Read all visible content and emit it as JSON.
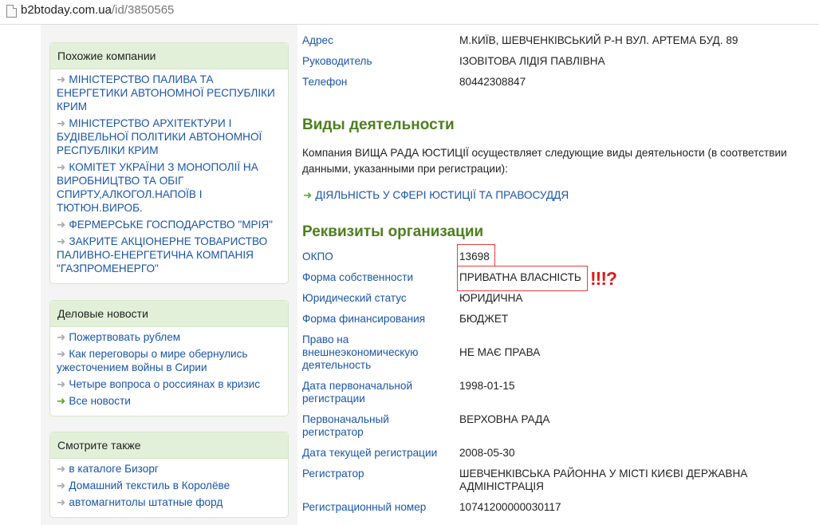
{
  "browser": {
    "url_domain": "b2btoday.com.ua",
    "url_path": "/id/3850565"
  },
  "sidebar": {
    "similar": {
      "title": "Похожие компании",
      "items": [
        "МІНІСТЕРСТВО ПАЛИВА ТА ЕНЕРГЕТИКИ АВТОНОМНОЇ РЕСПУБЛІКИ КРИМ",
        "МІНІСТЕРСТВО АРХІТЕКТУРИ І БУДІВЕЛЬНОЇ ПОЛІТИКИ АВТОНОМНОЇ РЕСПУБЛІКИ КРИМ",
        "КОМІТЕТ УКРАЇНИ З МОНОПОЛІЇ НА ВИРОБНИЦТВО ТА ОБІГ СПИРТУ,АЛКОГОЛ.НАПОЇВ І ТЮТЮН.ВИРОБ.",
        "ФЕРМЕРСЬКЕ ГОСПОДАРСТВО \"МРІЯ\"",
        "ЗАКРИТЕ АКЦІОНЕРНЕ ТОВАРИСТВО ПАЛИВНО-ЕНЕРГЕТИЧНА КОМПАНІЯ \"ГАЗПРОМЕНЕРГО\""
      ]
    },
    "news": {
      "title": "Деловые новости",
      "items": [
        "Пожертвовать рублем",
        "Как переговоры о мире обернулись ужесточением войны в Сирии",
        "Четыре вопроса о россиянах в кризис"
      ],
      "all_news": "Все новости"
    },
    "see_also": {
      "title": "Смотрите также",
      "items": [
        "в каталоге Бизорг",
        "Домашний текстиль в Королёве",
        "автомагнитолы штатные форд"
      ]
    }
  },
  "contacts": [
    {
      "label": "Адрес",
      "value": "М.КИЇВ, ШЕВЧЕНКІВСЬКИЙ Р-Н ВУЛ. АРТЕМА БУД. 89"
    },
    {
      "label": "Руководитель",
      "value": "ІЗОВІТОВА ЛІДІЯ ПАВЛІВНА"
    },
    {
      "label": "Телефон",
      "value": "80442308847"
    }
  ],
  "activities": {
    "heading": "Виды деятельности",
    "text": "Компания ВИЩА РАДА ЮСТИЦІЇ осуществляет следующие виды деятельности (в соответствии данными, указанными при регистрации):",
    "item": "ДІЯЛЬНІСТЬ У СФЕРІ ЮСТИЦІЇ ТА ПРАВОСУДДЯ"
  },
  "requisites": {
    "heading": "Реквизиты организации",
    "rows": [
      {
        "label": "ОКПО",
        "value": "13698"
      },
      {
        "label": "Форма собственности",
        "value": "ПРИВАТНА ВЛАСНІСТЬ"
      },
      {
        "label": "Юридический статус",
        "value": "ЮРИДИЧНА"
      },
      {
        "label": "Форма финансирования",
        "value": "БЮДЖЕТ"
      },
      {
        "label": "Право на внешнеэкономическую деятельность",
        "value": "НЕ МАЄ ПРАВА"
      },
      {
        "label": "Дата первоначальной регистрации",
        "value": "1998-01-15"
      },
      {
        "label": "Первоначальный регистратор",
        "value": "ВЕРХОВНА РАДА"
      },
      {
        "label": "Дата текущей регистрации",
        "value": "2008-05-30"
      },
      {
        "label": "Регистратор",
        "value": "ШЕВЧЕНКІВСЬКА РАЙОННА У МІСТІ КИЄВІ ДЕРЖАВНА АДМІНІСТРАЦІЯ"
      },
      {
        "label": "Регистрационный номер",
        "value": "10741200000030117"
      }
    ]
  },
  "annotation": {
    "marks": "!!!?",
    "color": "#e01919"
  }
}
